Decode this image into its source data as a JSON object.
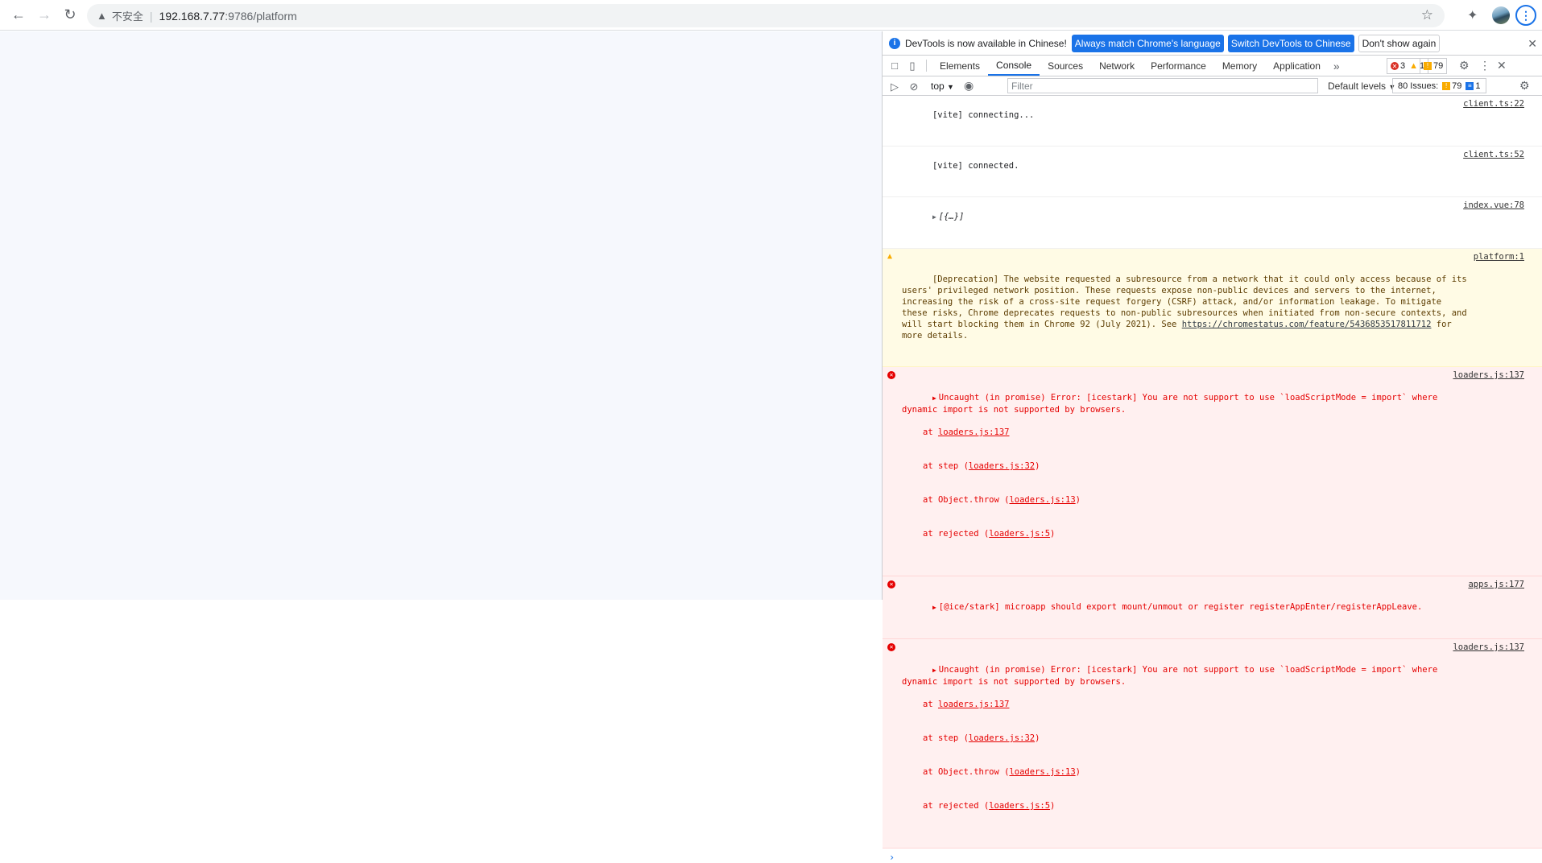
{
  "browser": {
    "insecure_label": "不安全",
    "url_host": "192.168.7.77",
    "url_path": ":9786/platform"
  },
  "devtools": {
    "infobar": {
      "message": "DevTools is now available in Chinese!",
      "btn_match": "Always match Chrome's language",
      "btn_switch": "Switch DevTools to Chinese",
      "btn_dismiss": "Don't show again"
    },
    "tabs": [
      "Elements",
      "Console",
      "Sources",
      "Network",
      "Performance",
      "Memory",
      "Application"
    ],
    "error_count": "3",
    "warning_count": "1",
    "issue_count": "79",
    "toolbar": {
      "context": "top",
      "filter_placeholder": "Filter",
      "levels": "Default levels",
      "issues_label": "80 Issues:",
      "issues_warn": "79",
      "issues_info": "1"
    },
    "console": [
      {
        "text": "[vite] connecting...",
        "src": "client.ts:22"
      },
      {
        "text": "[vite] connected.",
        "src": "client.ts:52"
      },
      {
        "text": "[{…}]",
        "src": "index.vue:78"
      },
      {
        "text": "[Deprecation] The website requested a subresource from a network that it could only access because of its users' privileged network position. These requests expose non-public devices and servers to the internet, increasing the risk of a cross-site request forgery (CSRF) attack, and/or information leakage. To mitigate these risks, Chrome deprecates requests to non-public subresources when initiated from non-secure contexts, and will start blocking them in Chrome 92 (July 2021). See ",
        "link": "https://chromestatus.com/feature/5436853517811712",
        "tail": " for more details.",
        "src": "platform:1"
      },
      {
        "text": "Uncaught (in promise) Error: [icestark] You are not support to use `loadScriptMode = import` where dynamic import is not supported by browsers.",
        "stack": [
          {
            "pre": "at ",
            "link": "loaders.js:137",
            "post": ""
          },
          {
            "pre": "at step (",
            "link": "loaders.js:32",
            "post": ")"
          },
          {
            "pre": "at Object.throw (",
            "link": "loaders.js:13",
            "post": ")"
          },
          {
            "pre": "at rejected (",
            "link": "loaders.js:5",
            "post": ")"
          }
        ],
        "src": "loaders.js:137"
      },
      {
        "text": "[@ice/stark] microapp should export mount/unmout or register registerAppEnter/registerAppLeave.",
        "src": "apps.js:177"
      },
      {
        "text": "Uncaught (in promise) Error: [icestark] You are not support to use `loadScriptMode = import` where dynamic import is not supported by browsers.",
        "stack": [
          {
            "pre": "at ",
            "link": "loaders.js:137",
            "post": ""
          },
          {
            "pre": "at step (",
            "link": "loaders.js:32",
            "post": ")"
          },
          {
            "pre": "at Object.throw (",
            "link": "loaders.js:13",
            "post": ")"
          },
          {
            "pre": "at rejected (",
            "link": "loaders.js:5",
            "post": ")"
          }
        ],
        "src": "loaders.js:137"
      }
    ]
  }
}
